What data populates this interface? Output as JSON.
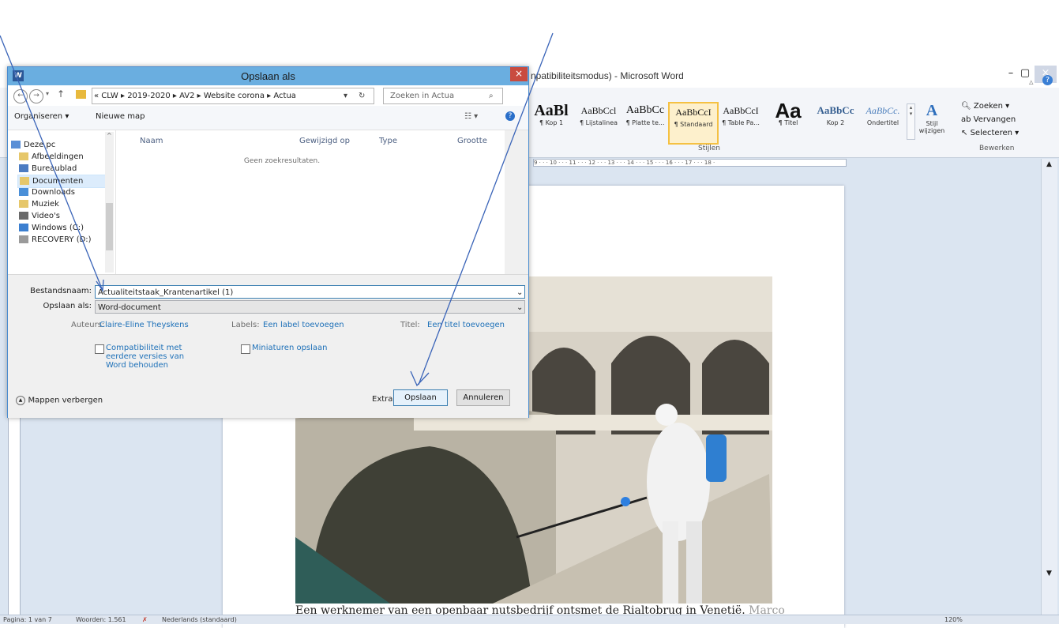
{
  "word": {
    "title": "npatibiliteitsmodus) - Microsoft Word",
    "styles": [
      {
        "preview": "AaBl",
        "label": "¶ Kop 1"
      },
      {
        "preview": "AaBbCcl",
        "label": "¶ Lijstalinea"
      },
      {
        "preview": "AaBbCc",
        "label": "¶ Platte te..."
      },
      {
        "preview": "AaBbCcI",
        "label": "¶ Standaard"
      },
      {
        "preview": "AaBbCcI",
        "label": "¶ Table Pa..."
      },
      {
        "preview": "Aa",
        "label": "¶ Titel"
      },
      {
        "preview": "AaBbCc",
        "label": "Kop 2"
      },
      {
        "preview": "AaBbCc.",
        "label": "Ondertitel"
      }
    ],
    "style_change": "Stijl wijzigen",
    "styles_group": "Stijlen",
    "editing": {
      "find": "Zoeken",
      "replace": "Vervangen",
      "select": "Selecteren",
      "group": "Bewerken"
    },
    "ruler_text": "9 · · · 10 · · · 11 · · · 12 · · · 13 · · · 14 · · · 15 · · · 16 · · · 17 · · · 18 ·",
    "caption_main": "Een werknemer van een openbaar nutsbedrijf ontsmet de ",
    "caption_word": "Rialtobrug",
    "caption_end": " in Venetië. ",
    "caption_tail": "Marco",
    "status": {
      "page": "Pagina: 1 van 7",
      "words": "Woorden: 1.561",
      "language": "Nederlands (standaard)",
      "zoom": "120%"
    }
  },
  "dialog": {
    "title": "Opslaan als",
    "close": "×",
    "breadcrumb": "« CLW ▸ 2019-2020 ▸ AV2 ▸ Website corona ▸ Actua",
    "search_placeholder": "Zoeken in Actua",
    "organize": "Organiseren ▾",
    "new_folder": "Nieuwe map",
    "nav_items": [
      "Deze pc",
      "Afbeeldingen",
      "Bureaublad",
      "Documenten",
      "Downloads",
      "Muziek",
      "Video's",
      "Windows (C:)",
      "RECOVERY (D:)"
    ],
    "columns": [
      "Naam",
      "Gewijzigd op",
      "Type",
      "Grootte"
    ],
    "empty_message": "Geen zoekresultaten.",
    "filename_label": "Bestandsnaam:",
    "filename_value": "Actualiteitstaak_Krantenartikel (1)",
    "saveas_label": "Opslaan als:",
    "saveas_value": "Word-document",
    "authors_label": "Auteurs:",
    "authors_value": "Claire-Eline Theyskens",
    "tags_label": "Labels:",
    "tags_value": "Een label toevoegen",
    "titel_label": "Titel:",
    "titel_value": "Een titel toevoegen",
    "compat_line1": "Compatibiliteit met",
    "compat_line2": "eerdere versies van",
    "compat_line3": "Word behouden",
    "thumbnails": "Miniaturen opslaan",
    "hide_folders": "Mappen verbergen",
    "tools": "Extra",
    "save": "Opslaan",
    "cancel": "Annuleren"
  },
  "colors": {
    "dialog_title_bar": "#6aaee0",
    "close_red": "#c94b3f",
    "link_blue": "#1d70b8",
    "arrow_blue": "#3a64b8"
  }
}
